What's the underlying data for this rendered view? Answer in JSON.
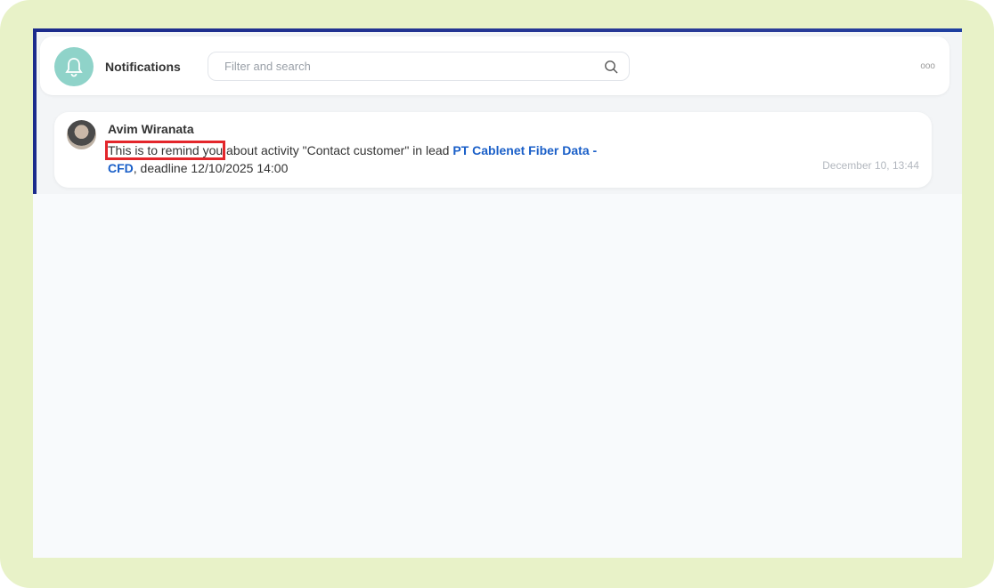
{
  "header": {
    "title": "Notifications",
    "search_placeholder": "Filter and search",
    "more_label": "ooo"
  },
  "notifications": [
    {
      "author": "Avim Wiranata",
      "message_highlight": "This is to remind you",
      "message_mid": " about activity \"Contact customer\" in lead ",
      "lead_link": "PT Cablenet Fiber Data - CFD",
      "message_end": ", deadline 12/10/2025 14:00",
      "timestamp": "December 10, 13:44"
    }
  ],
  "colors": {
    "accent": "#8fd3c9",
    "link": "#1a5fc8",
    "highlight": "#e3262b"
  }
}
